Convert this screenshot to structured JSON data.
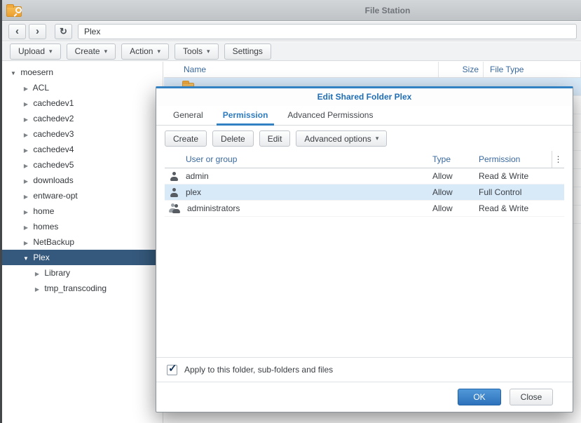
{
  "window": {
    "title": "File Station"
  },
  "icons": {
    "back": "‹",
    "forward": "›",
    "refresh": "↻",
    "caret": "▾",
    "collapsed": "▶",
    "expanded": "▼",
    "menu": "⋮",
    "check": "✓"
  },
  "nav": {
    "path": "Plex"
  },
  "toolbar": {
    "buttons": [
      {
        "label": "Upload"
      },
      {
        "label": "Create"
      },
      {
        "label": "Action"
      },
      {
        "label": "Tools"
      },
      {
        "label": "Settings"
      }
    ]
  },
  "sidebar": {
    "items": [
      {
        "label": "moesern",
        "level": 0,
        "state": "expanded",
        "selected": false
      },
      {
        "label": "ACL",
        "level": 1,
        "state": "collapsed",
        "selected": false
      },
      {
        "label": "cachedev1",
        "level": 1,
        "state": "collapsed",
        "selected": false
      },
      {
        "label": "cachedev2",
        "level": 1,
        "state": "collapsed",
        "selected": false
      },
      {
        "label": "cachedev3",
        "level": 1,
        "state": "collapsed",
        "selected": false
      },
      {
        "label": "cachedev4",
        "level": 1,
        "state": "collapsed",
        "selected": false
      },
      {
        "label": "cachedev5",
        "level": 1,
        "state": "collapsed",
        "selected": false
      },
      {
        "label": "downloads",
        "level": 1,
        "state": "collapsed",
        "selected": false
      },
      {
        "label": "entware-opt",
        "level": 1,
        "state": "collapsed",
        "selected": false
      },
      {
        "label": "home",
        "level": 1,
        "state": "collapsed",
        "selected": false
      },
      {
        "label": "homes",
        "level": 1,
        "state": "collapsed",
        "selected": false
      },
      {
        "label": "NetBackup",
        "level": 1,
        "state": "collapsed",
        "selected": false
      },
      {
        "label": "Plex",
        "level": 1,
        "state": "expanded",
        "selected": true
      },
      {
        "label": "Library",
        "level": 2,
        "state": "collapsed",
        "selected": false
      },
      {
        "label": "tmp_transcoding",
        "level": 2,
        "state": "collapsed",
        "selected": false
      }
    ]
  },
  "file_list": {
    "columns": [
      {
        "label": "Name"
      },
      {
        "label": "Size"
      },
      {
        "label": "File Type"
      }
    ]
  },
  "dialog": {
    "title": "Edit Shared Folder Plex",
    "tabs": [
      {
        "label": "General",
        "active": false
      },
      {
        "label": "Permission",
        "active": true
      },
      {
        "label": "Advanced Permissions",
        "active": false
      }
    ],
    "buttons": [
      {
        "label": "Create"
      },
      {
        "label": "Delete"
      },
      {
        "label": "Edit"
      },
      {
        "label": "Advanced options",
        "caret": true
      }
    ],
    "table": {
      "columns": [
        {
          "label": "User or group"
        },
        {
          "label": "Type"
        },
        {
          "label": "Permission"
        }
      ],
      "rows": [
        {
          "name": "admin",
          "icon": "user-icon",
          "type": "Allow",
          "permission": "Read & Write",
          "selected": false
        },
        {
          "name": "plex",
          "icon": "user-icon",
          "type": "Allow",
          "permission": "Full Control",
          "selected": true
        },
        {
          "name": "administrators",
          "icon": "group-icon",
          "type": "Allow",
          "permission": "Read & Write",
          "selected": false
        }
      ]
    },
    "checkbox": {
      "label": "Apply to this folder, sub-folders and files",
      "checked": true
    },
    "footer": {
      "ok_label": "OK",
      "close_label": "Close"
    }
  },
  "colors": {
    "accent": "#2e7cc0",
    "tree_selection": "#35597c",
    "row_highlight": "#d8e9f8",
    "ok_button": "#2d72bb",
    "folder_icon": "#efa93f"
  }
}
